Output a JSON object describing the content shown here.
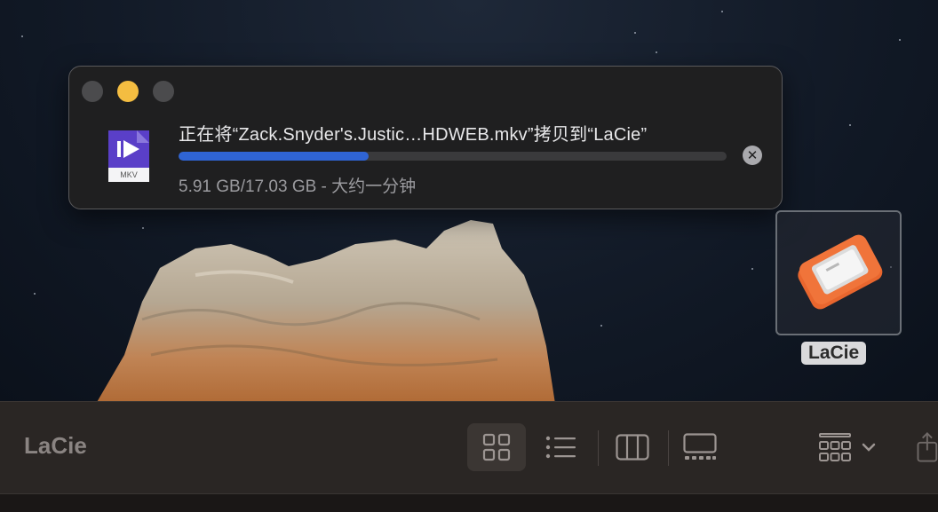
{
  "copy_dialog": {
    "title": "正在将“Zack.Snyder's.Justic…HDWEB.mkv”拷贝到“LaCie”",
    "status": "5.91 GB/17.03 GB - 大约一分钟",
    "progress_fraction": 0.347,
    "file_badge": "MKV",
    "cancel_icon": "close-circle-icon",
    "traffic_lights": {
      "close": "#4b4b4d",
      "minimize": "#f4bd41",
      "zoom": "#4b4b4d"
    }
  },
  "desktop": {
    "drive_label": "LaCie",
    "drive_color": "#f0743a"
  },
  "toolbar": {
    "title": "LaCie",
    "view_buttons": [
      "grid-view-icon",
      "list-view-icon",
      "column-view-icon",
      "gallery-view-icon"
    ],
    "active_view": "grid-view-icon",
    "group_icon": "group-by-icon",
    "share_icon": "share-icon"
  },
  "colors": {
    "progress": "#2f64d4",
    "accent_yellow": "#f4bd41"
  }
}
